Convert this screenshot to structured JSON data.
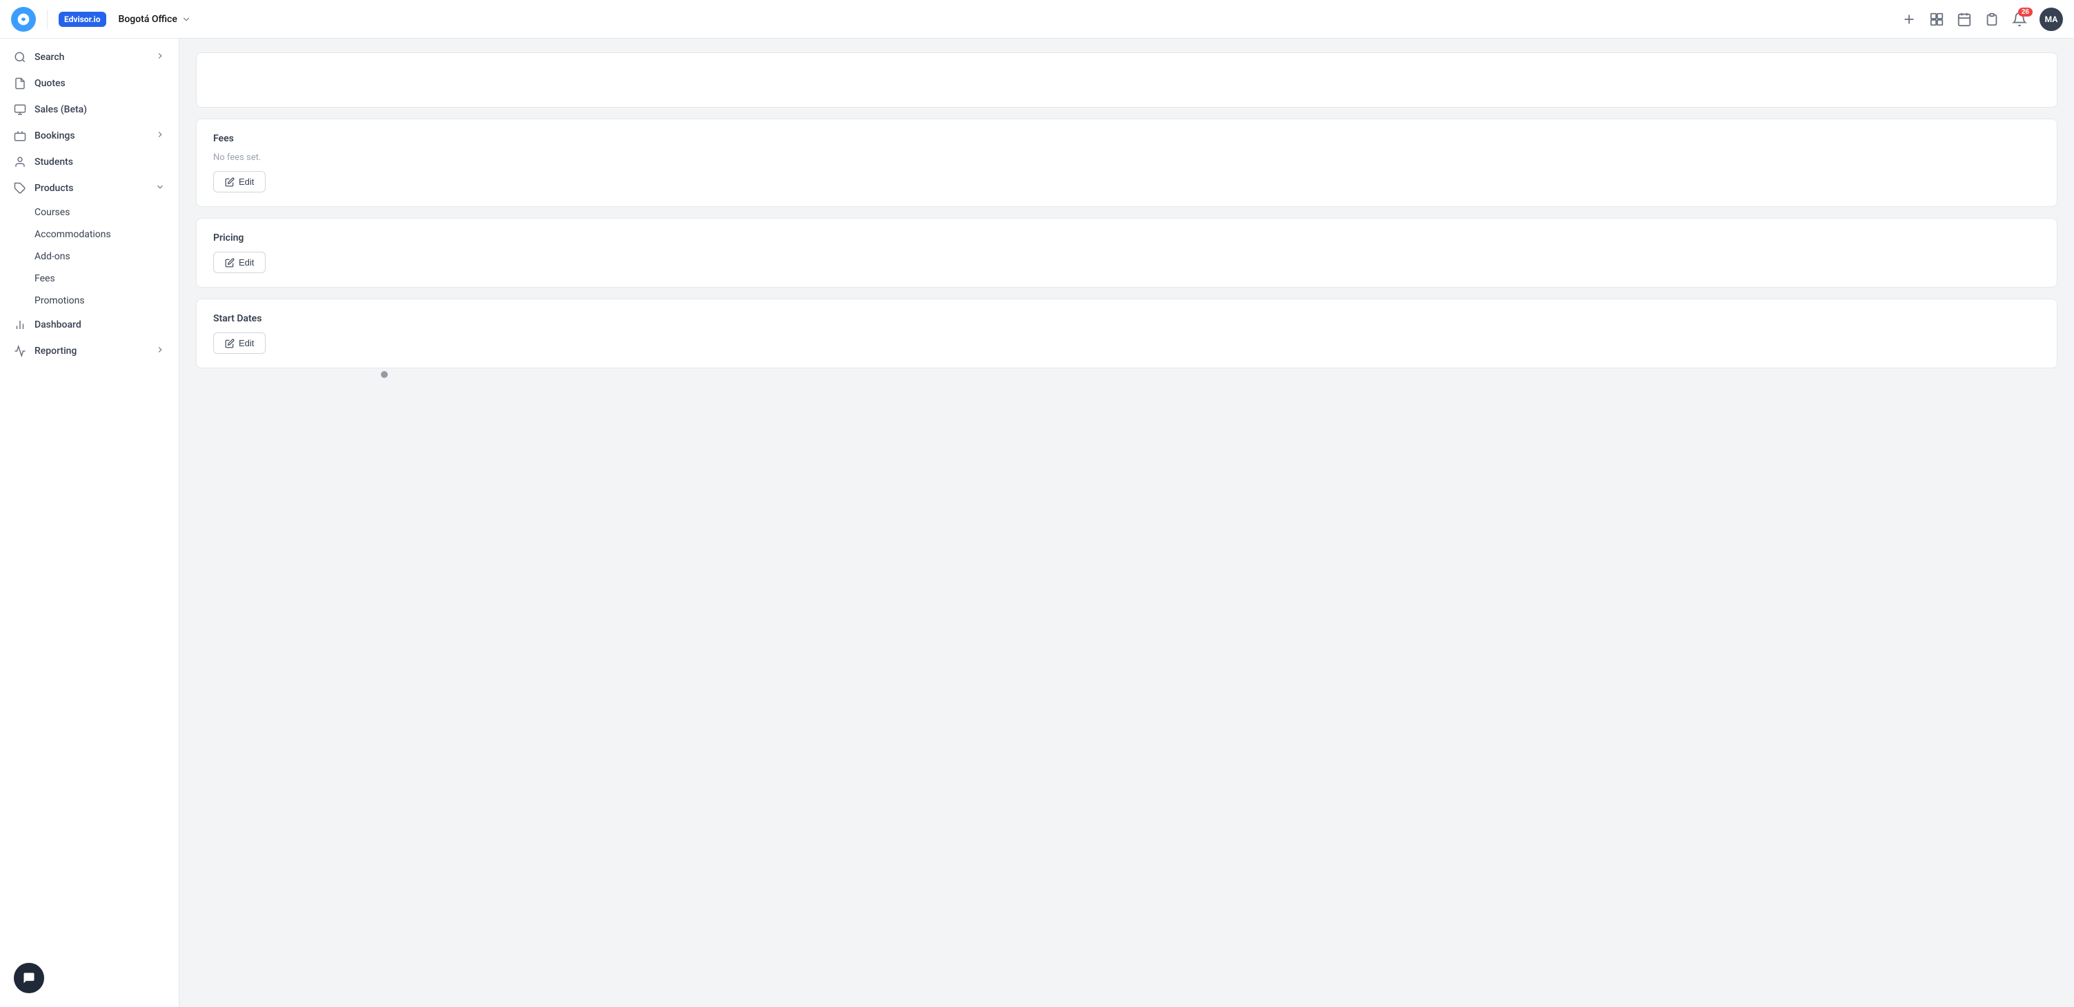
{
  "topnav": {
    "office_name": "Bogotá Office",
    "notifications_count": "26",
    "avatar_initials": "MA",
    "add_button_label": "+",
    "edvisor_label": "Edvisor.io"
  },
  "sidebar": {
    "items": [
      {
        "id": "search",
        "label": "Search",
        "has_chevron": true
      },
      {
        "id": "quotes",
        "label": "Quotes",
        "has_chevron": false
      },
      {
        "id": "sales",
        "label": "Sales (Beta)",
        "has_chevron": false
      },
      {
        "id": "bookings",
        "label": "Bookings",
        "has_chevron": true
      },
      {
        "id": "students",
        "label": "Students",
        "has_chevron": false
      },
      {
        "id": "products",
        "label": "Products",
        "has_chevron": true,
        "expanded": true
      }
    ],
    "products_sub": [
      {
        "id": "courses",
        "label": "Courses"
      },
      {
        "id": "accommodations",
        "label": "Accommodations"
      },
      {
        "id": "addons",
        "label": "Add-ons"
      },
      {
        "id": "fees",
        "label": "Fees"
      },
      {
        "id": "promotions",
        "label": "Promotions"
      }
    ],
    "bottom_items": [
      {
        "id": "dashboard",
        "label": "Dashboard",
        "has_chevron": false
      },
      {
        "id": "reporting",
        "label": "Reporting",
        "has_chevron": true
      }
    ]
  },
  "content": {
    "fees_section": {
      "title": "Fees",
      "no_fees_text": "No fees set.",
      "edit_label": "Edit"
    },
    "pricing_section": {
      "title": "Pricing",
      "edit_label": "Edit"
    },
    "start_dates_section": {
      "title": "Start Dates",
      "edit_label": "Edit"
    }
  },
  "icons": {
    "search": "🔍",
    "quotes": "📄",
    "sales": "🖥",
    "bookings": "💼",
    "students": "👤",
    "products": "🏷",
    "dashboard": "📊",
    "reporting": "📈",
    "pencil": "✏"
  }
}
